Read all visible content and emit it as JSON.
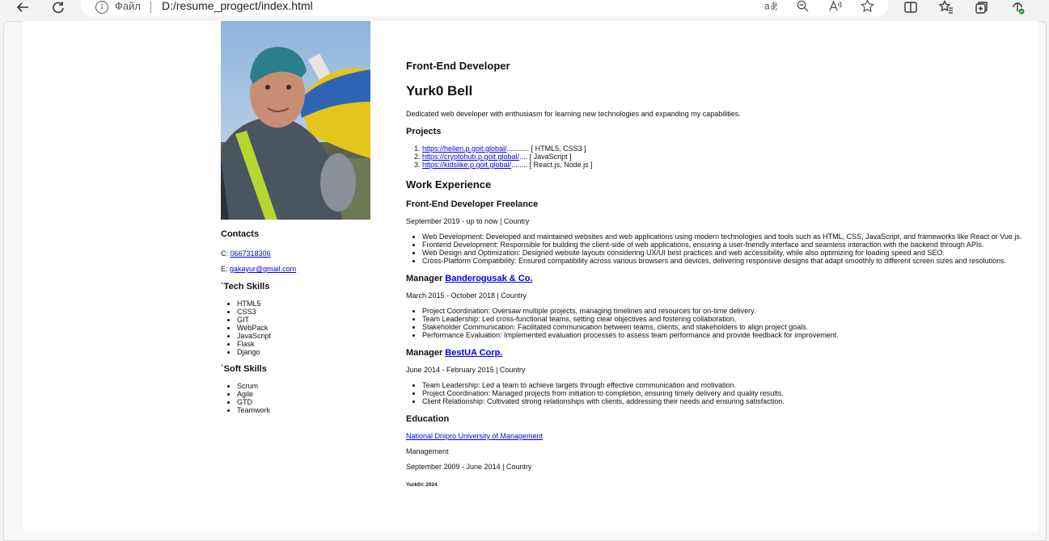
{
  "browser": {
    "scheme_label": "Файл",
    "url": "D:/resume_progect/index.html"
  },
  "sidebar": {
    "contacts_title": "Contacts",
    "phone_prefix": "C: ",
    "phone": "0667318306",
    "email_prefix": "E: ",
    "email": "gakayur@gmail.com",
    "tech_title": "`Tech Skills",
    "tech_skills": [
      "HTML5",
      "CSS3",
      "GIT",
      "WebPack",
      "JavaScript",
      "Flask",
      "Django"
    ],
    "soft_title": "`Soft Skills",
    "soft_skills": [
      "Scrum",
      "Agile",
      "GTD",
      "Teamwork"
    ]
  },
  "main": {
    "role": "Front-End Developer",
    "name": "Yurk0 Bell",
    "summary": "Dedicated web developer with enthusiasm for learning new technologies and expanding my capabilities.",
    "projects_title": "Projects",
    "projects": [
      {
        "url": "https://hellen.p.goit.global/",
        "tech": "........... [ HTML5, CSS3 ]"
      },
      {
        "url": "https://cryptohub.p.goit.global/",
        "tech": ".... [ JavaScript ]"
      },
      {
        "url": "https://kidslike.p.goit.global/",
        "tech": "........ [ React.js, Node.js ]"
      }
    ],
    "work_title": "Work Experience",
    "jobs": [
      {
        "title": "Front-End Developer Freelance",
        "company": "",
        "period": "September 2019 - up to now | Country",
        "duties": [
          "Web Development: Developed and maintained websites and web applications using modern technologies and tools such as HTML, CSS, JavaScript, and frameworks like React or Vue.js.",
          "Frontend Development: Responsible for building the client-side of web applications, ensuring a user-friendly interface and seamless interaction with the backend through APIs.",
          "Web Design and Optimization: Designed website layouts considering UX/UI best practices and web accessibility, while also optimizing for loading speed and SEO.",
          "Cross-Platform Compatibility: Ensured compatibility across various browsers and devices, delivering responsive designs that adapt smoothly to different screen sizes and resolutions."
        ]
      },
      {
        "title": "Manager ",
        "company": "Banderogusak & Co.",
        "period": "March 2015 - October 2018 | Country",
        "duties": [
          "Project Coordination: Oversaw multiple projects, managing timelines and resources for on-time delivery.",
          "Team Leadership: Led cross-functional teams, setting clear objectives and fostering collaboration.",
          "Stakeholder Communication: Facilitated communication between teams, clients, and stakeholders to align project goals.",
          "Performance Evaluation: Implemented evaluation processes to assess team performance and provide feedback for improvement."
        ]
      },
      {
        "title": "Manager ",
        "company": "BestUA Corp.",
        "period": "June 2014 - February 2015 | Country",
        "duties": [
          "Team Leadership: Led a team to achieve targets through effective communication and motivation.",
          "Project Coordination: Managed projects from initiation to completion, ensuring timely delivery and quality results.",
          "Client Relationship: Cultivated strong relationships with clients, addressing their needs and ensuring satisfaction."
        ]
      }
    ],
    "education_title": "Education",
    "university": "National Dnipro University of Management",
    "major": "Management",
    "edu_period": "September 2009 - June 2014 | Country",
    "footer": "Yurk0© 2024"
  }
}
